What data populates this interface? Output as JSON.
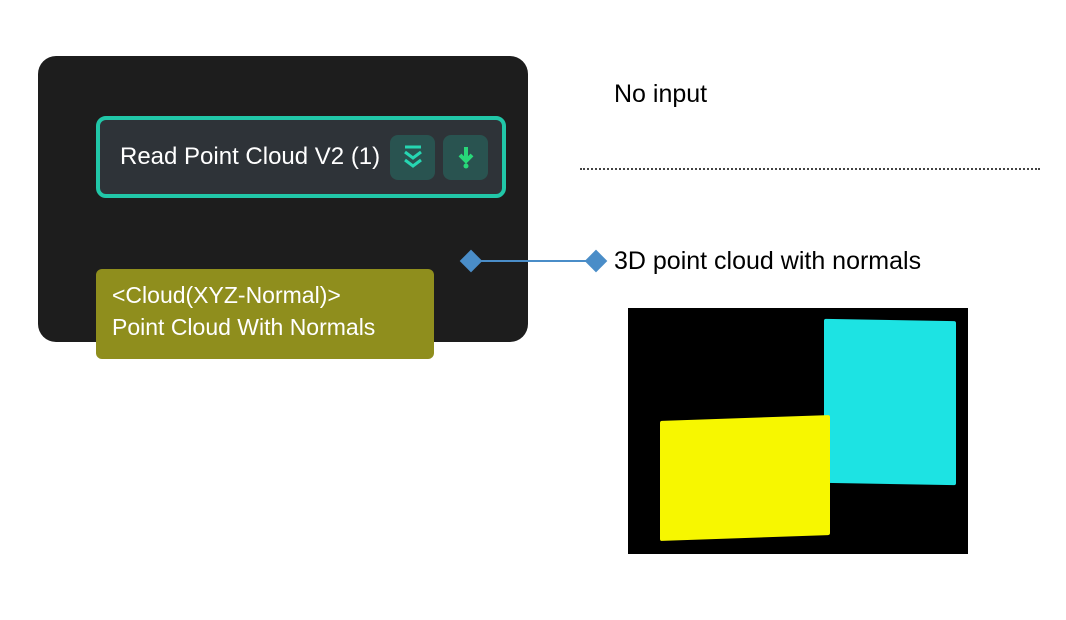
{
  "node": {
    "title": "Read Point Cloud V2 (1)",
    "output": {
      "type_label": "<Cloud(XYZ-Normal)>",
      "name": "Point Cloud With Normals"
    }
  },
  "labels": {
    "no_input": "No input",
    "output_description": "3D point cloud with normals"
  },
  "colors": {
    "accent": "#21c7a8",
    "output_bg": "#8f8e1d",
    "port": "#4a8dc8",
    "preview_cyan": "#1de3e3",
    "preview_yellow": "#f7f700"
  }
}
